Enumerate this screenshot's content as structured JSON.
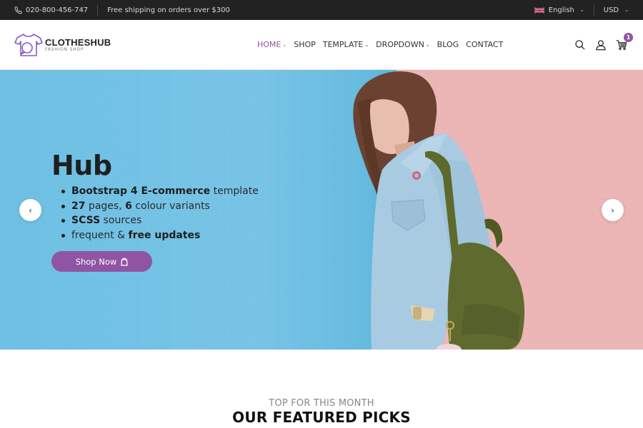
{
  "topbar": {
    "phone": "020-800-456-747",
    "shipping_notice": "Free shipping on orders over $300",
    "language": "English",
    "currency": "USD"
  },
  "header": {
    "logo": {
      "name": "CLOTHESHUB",
      "tagline": "FASHION SHOP"
    },
    "nav": [
      {
        "label": "HOME",
        "dropdown": true,
        "active": true
      },
      {
        "label": "SHOP",
        "dropdown": false,
        "active": false
      },
      {
        "label": "TEMPLATE",
        "dropdown": true,
        "active": false
      },
      {
        "label": "DROPDOWN",
        "dropdown": true,
        "active": false
      },
      {
        "label": "BLOG",
        "dropdown": false,
        "active": false
      },
      {
        "label": "CONTACT",
        "dropdown": false,
        "active": false
      }
    ],
    "icons": [
      "search-icon",
      "user-icon",
      "cart-icon"
    ],
    "cart_count": "1"
  },
  "hero": {
    "title": "Hub",
    "features": [
      {
        "bold": "Bootstrap 4 E-commerce",
        "rest": " template"
      },
      {
        "bold": "27",
        "rest": " pages, ",
        "bold2": "6",
        "rest2": " colour variants"
      },
      {
        "bold": "SCSS",
        "rest": " sources"
      },
      {
        "pre": "frequent & ",
        "bold": "free updates"
      }
    ],
    "cta_label": "Shop Now",
    "prev_label": "‹",
    "next_label": "›"
  },
  "featured": {
    "kicker": "TOP FOR THIS MONTH",
    "title": "OUR FEATURED PICKS"
  },
  "colors": {
    "accent": "#9055a2",
    "topbar_bg": "#222222",
    "hero_blue": "#6ec0e4",
    "hero_pink": "#ecb5b6"
  }
}
